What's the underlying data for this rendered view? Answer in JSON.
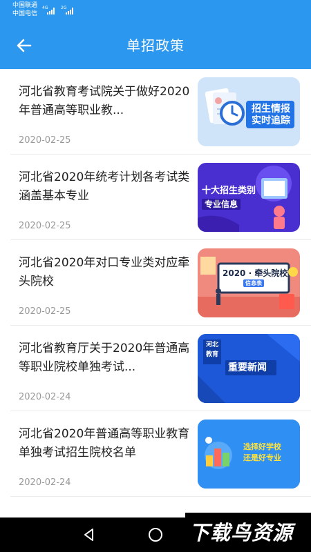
{
  "status_bar": {
    "carrier_1": "中国联通",
    "carrier_2": "中国电信",
    "net_1": "4G",
    "net_2": "2G"
  },
  "header": {
    "title": "单招政策",
    "back_icon": "arrow-left-icon",
    "background": "#2b97ee"
  },
  "articles": [
    {
      "title": "河北省教育考试院关于做好2020年普通高等职业教...",
      "date": "2020-02-25",
      "thumb_caption": [
        "招生情报",
        "实时追踪"
      ]
    },
    {
      "title": "河北省2020年统考计划各考试类涵盖基本专业",
      "date": "2020-02-25",
      "thumb_caption": [
        "十大招生类别",
        "专业信息"
      ]
    },
    {
      "title": "河北省2020年对口专业类对应牵头院校",
      "date": "2020-02-25",
      "thumb_caption": [
        "2020 · 牵头院校",
        "信息表"
      ]
    },
    {
      "title": "河北省教育厅关于2020年普通高等职业院校单独考试...",
      "date": "2020-02-24",
      "thumb_caption": [
        "河北",
        "教育",
        "重要新闻"
      ]
    },
    {
      "title": "河北省2020年普通高等职业教育单独考试招生院校名单",
      "date": "2020-02-24",
      "thumb_caption": [
        "选择好学校",
        "还是好专业"
      ]
    }
  ],
  "nav_bar": {
    "back_icon": "triangle-back-icon",
    "home_icon": "circle-home-icon",
    "recents_icon": "square-recents-icon"
  },
  "watermark": {
    "text": "下载鸟资源"
  }
}
